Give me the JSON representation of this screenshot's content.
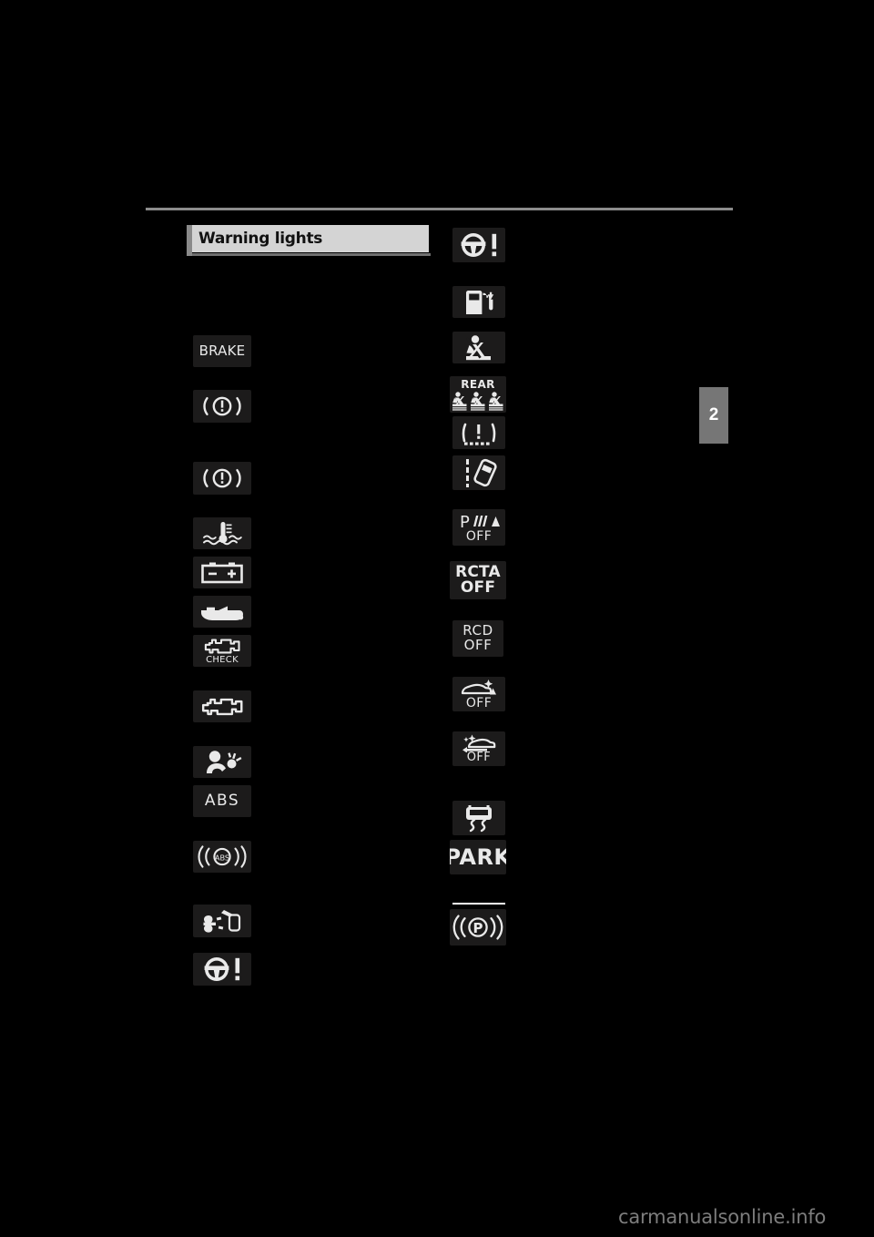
{
  "page": {
    "background_color": "#000000",
    "chapter_tab": {
      "label": "2",
      "color": "#767676"
    },
    "header_rule_color": "#8c8c8c"
  },
  "section": {
    "title": "Warning lights",
    "title_bar_color": "#d4d4d4",
    "title_text_color": "#111111"
  },
  "footer": {
    "watermark": "carmanualsonline.info",
    "watermark_color": "#7d7d7d"
  },
  "tile_style": {
    "background": "#1c1b1b",
    "glyph_color": "#e9e9e9"
  },
  "left_column": [
    {
      "name": "brake-system-warning-text",
      "text": "BRAKE",
      "icon": "text-brake"
    },
    {
      "name": "brake-system-warning-symbol",
      "text": "",
      "icon": "brake-circle-exclamation"
    },
    {
      "name": "brake-system-warning-symbol-2",
      "text": "",
      "icon": "brake-circle-exclamation"
    },
    {
      "name": "engine-coolant-temperature-warning",
      "text": "",
      "icon": "coolant-temperature"
    },
    {
      "name": "charging-system-warning",
      "text": "",
      "icon": "battery"
    },
    {
      "name": "low-engine-oil-pressure-warning",
      "text": "",
      "icon": "oil-can"
    },
    {
      "name": "malfunction-indicator-check",
      "text": "CHECK",
      "icon": "engine-check"
    },
    {
      "name": "malfunction-indicator-lamp",
      "text": "",
      "icon": "engine"
    },
    {
      "name": "srs-airbag-warning",
      "text": "",
      "icon": "srs-airbag"
    },
    {
      "name": "abs-warning-text",
      "text": "ABS",
      "icon": "text-abs"
    },
    {
      "name": "brake-assist-warning",
      "text": "ABS",
      "icon": "abs-circle-waves"
    },
    {
      "name": "slip-indicator-warning",
      "text": "",
      "icon": "slip-skid"
    },
    {
      "name": "electric-power-steering-warning",
      "text": "",
      "icon": "steering-wheel-exclamation"
    }
  ],
  "right_column": [
    {
      "name": "electric-power-steering-warning",
      "text": "",
      "icon": "steering-wheel-exclamation"
    },
    {
      "name": "low-fuel-level-warning",
      "text": "",
      "icon": "fuel-pump"
    },
    {
      "name": "driver-seat-belt-reminder",
      "text": "",
      "icon": "seat-belt"
    },
    {
      "name": "rear-passenger-seat-belt-reminder",
      "text": "REAR",
      "icon": "rear-seat-belts"
    },
    {
      "name": "tire-pressure-warning",
      "text": "",
      "icon": "tire-pressure"
    },
    {
      "name": "lane-departure-alert-warning",
      "text": "",
      "icon": "lane-departure"
    },
    {
      "name": "parking-assist-off-indicator",
      "text": "OFF",
      "icon": "parking-sonar-off"
    },
    {
      "name": "rcta-off-indicator",
      "text": "RCTA\nOFF",
      "icon": "text-rcta-off"
    },
    {
      "name": "rcd-off-indicator",
      "text": "RCD\nOFF",
      "icon": "text-rcd-off"
    },
    {
      "name": "pcs-warning-off-indicator",
      "text": "OFF",
      "icon": "pcs-off"
    },
    {
      "name": "lda-off-indicator",
      "text": "OFF",
      "icon": "lda-off"
    },
    {
      "name": "vsc-off-indicator",
      "text": "",
      "icon": "vsc-skid-car"
    },
    {
      "name": "park-indicator",
      "text": "PARK",
      "icon": "text-park"
    },
    {
      "name": "parking-brake-indicator",
      "text": "",
      "icon": "parking-brake-p"
    }
  ],
  "labels": {
    "rcta_line1": "RCTA",
    "rcta_line2": "OFF",
    "rcd_line1": "RCD",
    "rcd_line2": "OFF",
    "off": "OFF",
    "rear": "REAR",
    "check": "CHECK",
    "brake": "BRAKE",
    "abs": "ABS",
    "abs_small": "ABS",
    "park": "PARK",
    "p_letter": "P"
  }
}
